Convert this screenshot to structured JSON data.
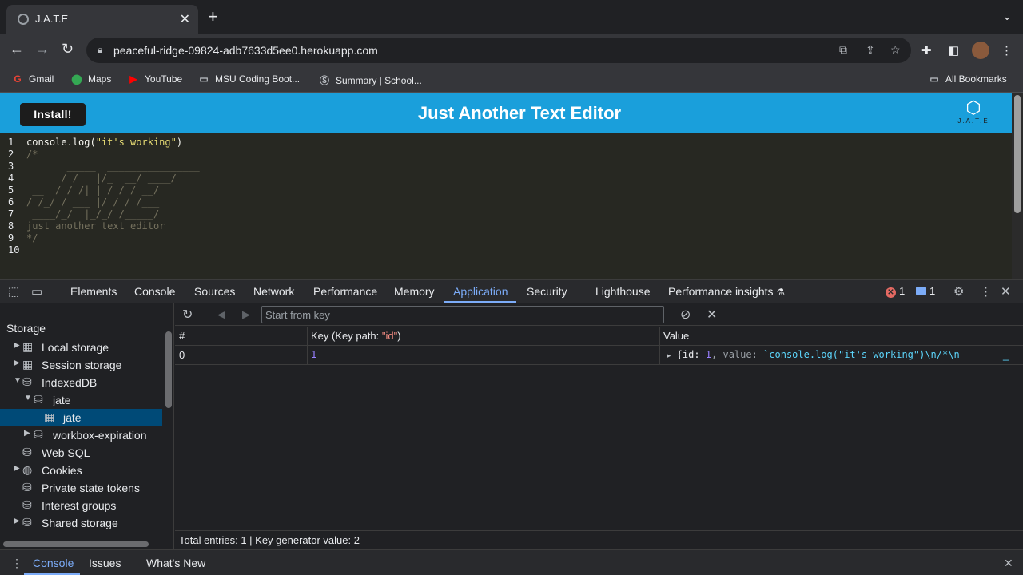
{
  "browser": {
    "tab_title": "J.A.T.E",
    "url": "peaceful-ridge-09824-adb7633d5ee0.herokuapp.com",
    "bookmarks": [
      {
        "label": "Gmail",
        "icon": "gmail-icon"
      },
      {
        "label": "Maps",
        "icon": "maps-icon"
      },
      {
        "label": "YouTube",
        "icon": "youtube-icon"
      },
      {
        "label": "MSU Coding Boot...",
        "icon": "folder-icon"
      },
      {
        "label": "Summary | School...",
        "icon": "s-site-icon"
      }
    ],
    "all_bookmarks": "All Bookmarks"
  },
  "app": {
    "install_label": "Install!",
    "title": "Just Another Text Editor",
    "logo_text": "J.A.T.E",
    "header_color": "#1a9fdb"
  },
  "editor": {
    "line_numbers": [
      "1",
      "2",
      "3",
      "4",
      "5",
      "6",
      "7",
      "8",
      "9",
      "10"
    ],
    "lines": [
      "console.log(\"it's working\")",
      "/*",
      "       _____  ________________",
      "      / /   |/_  __/ ____/",
      " __  / / /| | / / / __/",
      "/ /_/ / ___ |/ / / /___",
      " ____/_/  |_/_/ /_____/",
      "just another text editor",
      "*/",
      ""
    ],
    "code_prefix": "console.",
    "code_fn": "log(",
    "code_string": "\"it's working\"",
    "code_suffix": ")"
  },
  "devtools": {
    "tabs": [
      "Elements",
      "Console",
      "Sources",
      "Network",
      "Performance",
      "Memory",
      "Application",
      "Security",
      "Lighthouse",
      "Performance insights"
    ],
    "active_tab": "Application",
    "error_count": "1",
    "message_count": "1",
    "sidebar": {
      "heading": "Storage",
      "items": [
        {
          "label": "Local storage"
        },
        {
          "label": "Session storage"
        },
        {
          "label": "IndexedDB"
        },
        {
          "label": "jate"
        },
        {
          "label": "jate"
        },
        {
          "label": "workbox-expiration"
        },
        {
          "label": "Web SQL"
        },
        {
          "label": "Cookies"
        },
        {
          "label": "Private state tokens"
        },
        {
          "label": "Interest groups"
        },
        {
          "label": "Shared storage"
        }
      ]
    },
    "panel": {
      "key_placeholder": "Start from key",
      "columns": [
        "#",
        "Key (Key path: ",
        "\"id\"",
        ")",
        "Value"
      ],
      "row": {
        "index": "0",
        "key": "1",
        "value_id_label": "{id: ",
        "value_id": "1",
        "value_sep": ", value: ",
        "value_str": "`console.log(\"it's working\")\\n/*\\n",
        "value_trail": "_"
      },
      "footer": "Total entries: 1 | Key generator value: 2"
    },
    "drawer_tabs": [
      "Console",
      "Issues",
      "What's New"
    ]
  }
}
